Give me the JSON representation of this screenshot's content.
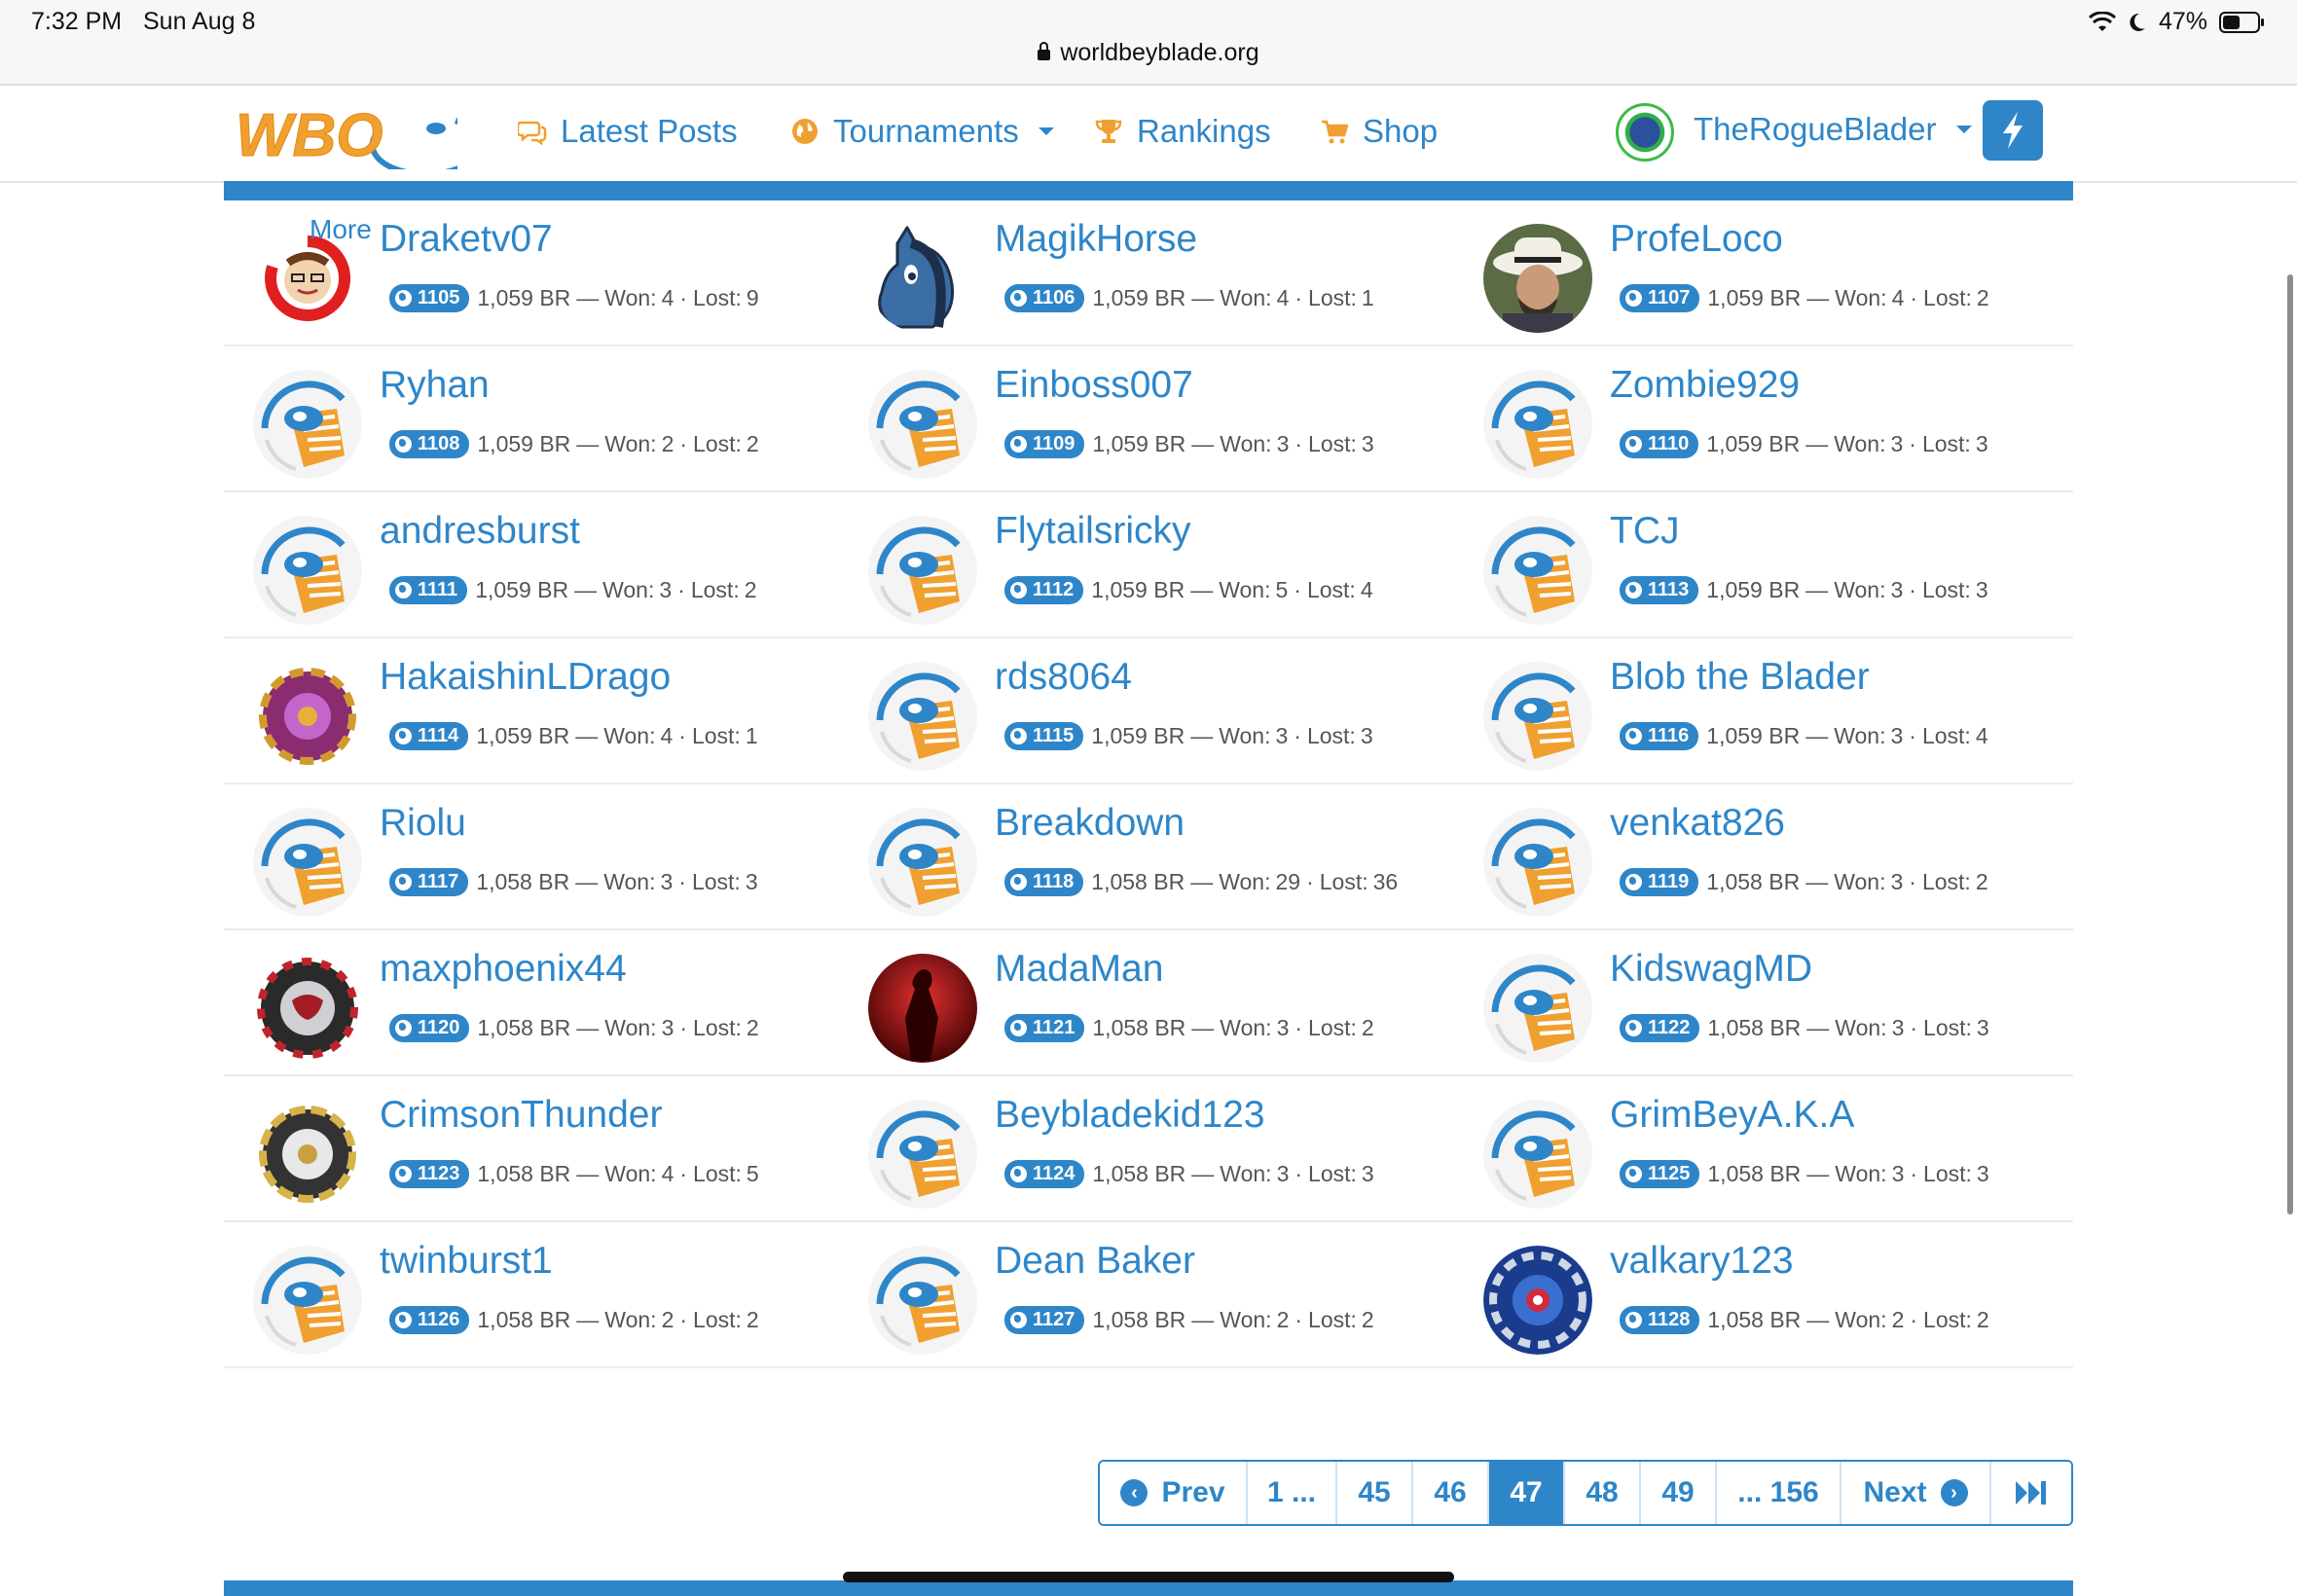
{
  "status": {
    "time": "7:32 PM",
    "date": "Sun Aug 8",
    "battery": "47%"
  },
  "url": "worldbeyblade.org",
  "nav": {
    "logo_text": "WBO",
    "latest_posts": "Latest Posts",
    "tournaments": "Tournaments",
    "rankings": "Rankings",
    "shop": "Shop",
    "username": "TheRogueBlader"
  },
  "more_label": "More",
  "players": [
    {
      "name": "Draketv07",
      "rank": "1105",
      "br": "1,059 BR",
      "won": "4",
      "lost": "9",
      "avatar": "drake"
    },
    {
      "name": "MagikHorse",
      "rank": "1106",
      "br": "1,059 BR",
      "won": "4",
      "lost": "1",
      "avatar": "horse"
    },
    {
      "name": "ProfeLoco",
      "rank": "1107",
      "br": "1,059 BR",
      "won": "4",
      "lost": "2",
      "avatar": "photo"
    },
    {
      "name": "Ryhan",
      "rank": "1108",
      "br": "1,059 BR",
      "won": "2",
      "lost": "2",
      "avatar": "default"
    },
    {
      "name": "Einboss007",
      "rank": "1109",
      "br": "1,059 BR",
      "won": "3",
      "lost": "3",
      "avatar": "default"
    },
    {
      "name": "Zombie929",
      "rank": "1110",
      "br": "1,059 BR",
      "won": "3",
      "lost": "3",
      "avatar": "default"
    },
    {
      "name": "andresburst",
      "rank": "1111",
      "br": "1,059 BR",
      "won": "3",
      "lost": "2",
      "avatar": "default"
    },
    {
      "name": "Flytailsricky",
      "rank": "1112",
      "br": "1,059 BR",
      "won": "5",
      "lost": "4",
      "avatar": "default"
    },
    {
      "name": "TCJ",
      "rank": "1113",
      "br": "1,059 BR",
      "won": "3",
      "lost": "3",
      "avatar": "default"
    },
    {
      "name": "HakaishinLDrago",
      "rank": "1114",
      "br": "1,059 BR",
      "won": "4",
      "lost": "1",
      "avatar": "bey-purple"
    },
    {
      "name": "rds8064",
      "rank": "1115",
      "br": "1,059 BR",
      "won": "3",
      "lost": "3",
      "avatar": "default"
    },
    {
      "name": "Blob the Blader",
      "rank": "1116",
      "br": "1,059 BR",
      "won": "3",
      "lost": "4",
      "avatar": "default"
    },
    {
      "name": "Riolu",
      "rank": "1117",
      "br": "1,058 BR",
      "won": "3",
      "lost": "3",
      "avatar": "default"
    },
    {
      "name": "Breakdown",
      "rank": "1118",
      "br": "1,058 BR",
      "won": "29",
      "lost": "36",
      "avatar": "default"
    },
    {
      "name": "venkat826",
      "rank": "1119",
      "br": "1,058 BR",
      "won": "3",
      "lost": "2",
      "avatar": "default"
    },
    {
      "name": "maxphoenix44",
      "rank": "1120",
      "br": "1,058 BR",
      "won": "3",
      "lost": "2",
      "avatar": "bey-red"
    },
    {
      "name": "MadaMan",
      "rank": "1121",
      "br": "1,058 BR",
      "won": "3",
      "lost": "2",
      "avatar": "red"
    },
    {
      "name": "KidswagMD",
      "rank": "1122",
      "br": "1,058 BR",
      "won": "3",
      "lost": "3",
      "avatar": "default"
    },
    {
      "name": "CrimsonThunder",
      "rank": "1123",
      "br": "1,058 BR",
      "won": "4",
      "lost": "5",
      "avatar": "bey-gold"
    },
    {
      "name": "Beybladekid123",
      "rank": "1124",
      "br": "1,058 BR",
      "won": "3",
      "lost": "3",
      "avatar": "default"
    },
    {
      "name": "GrimBeyA.K.A",
      "rank": "1125",
      "br": "1,058 BR",
      "won": "3",
      "lost": "3",
      "avatar": "default"
    },
    {
      "name": "twinburst1",
      "rank": "1126",
      "br": "1,058 BR",
      "won": "2",
      "lost": "2",
      "avatar": "default"
    },
    {
      "name": "Dean Baker",
      "rank": "1127",
      "br": "1,058 BR",
      "won": "2",
      "lost": "2",
      "avatar": "default"
    },
    {
      "name": "valkary123",
      "rank": "1128",
      "br": "1,058 BR",
      "won": "2",
      "lost": "2",
      "avatar": "bey-blue"
    }
  ],
  "stats_labels": {
    "sep": "—",
    "won": "Won:",
    "lost": "Lost:",
    "dot": "·"
  },
  "pagination": {
    "prev": "Prev",
    "pages": [
      "1 ...",
      "45",
      "46",
      "47",
      "48",
      "49",
      "... 156"
    ],
    "active": "47",
    "next": "Next"
  },
  "colors": {
    "accent": "#2e86c9",
    "logo_orange": "#f0a030"
  }
}
